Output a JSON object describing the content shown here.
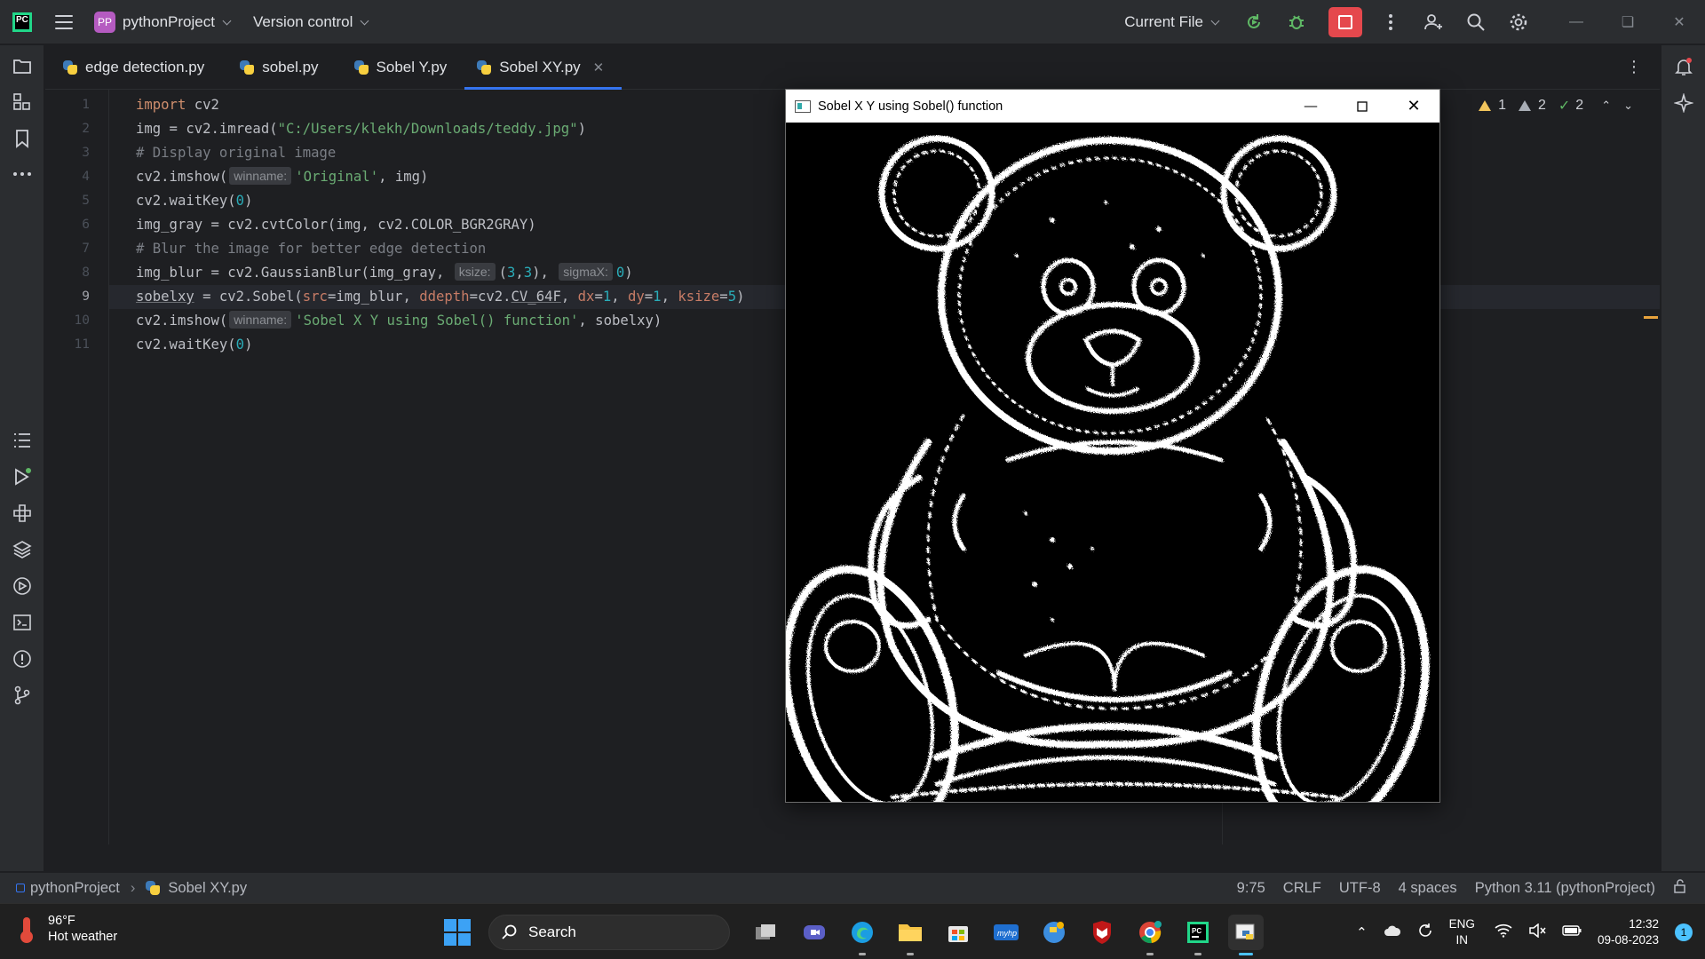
{
  "titlebar": {
    "project_badge": "PP",
    "project_name": "pythonProject",
    "version_control": "Version control",
    "run_config": "Current File"
  },
  "tabs": [
    {
      "label": "edge detection.py"
    },
    {
      "label": "sobel.py"
    },
    {
      "label": "Sobel Y.py"
    },
    {
      "label": "Sobel XY.py",
      "active": true
    }
  ],
  "editor": {
    "line_numbers": [
      "1",
      "2",
      "3",
      "4",
      "5",
      "6",
      "7",
      "8",
      "9",
      "10",
      "11"
    ],
    "current_line": 9,
    "lines": {
      "l1": {
        "kw": "import",
        "rest": " cv2"
      },
      "l2": {
        "a": "img = cv2.imread(",
        "str": "\"C:/Users/klekh/Downloads/teddy.jpg\"",
        "b": ")"
      },
      "l3": {
        "cmt": "# Display original image"
      },
      "l4": {
        "a": "cv2.imshow(",
        "hint": "winname:",
        "str": "'Original'",
        "b": ", img)"
      },
      "l5": {
        "a": "cv2.waitKey(",
        "num": "0",
        "b": ")"
      },
      "l6": {
        "a": "img_gray = cv2.cvtColor(img, cv2.COLOR_BGR2GRAY)"
      },
      "l7": {
        "cmt": "# Blur the image for better edge detection"
      },
      "l8": {
        "a": "img_blur = cv2.GaussianBlur(img_gray, ",
        "hint1": "ksize:",
        "n1": "3",
        "n2": "3",
        "hint2": "sigmaX:",
        "n3": "0"
      },
      "l9": {
        "var": "sobelxy",
        "a": " = cv2.Sobel(",
        "p1": "src",
        "v1": "=img_blur, ",
        "p2": "ddepth",
        "v2a": "=cv2.",
        "v2b": "CV_64F",
        "c1": ", ",
        "p3": "dx",
        "n1": "1",
        "c2": ", ",
        "p4": "dy",
        "n2": "1",
        "c3": ", ",
        "p5": "ksize",
        "n3": "5",
        "b": ")"
      },
      "l10": {
        "a": "cv2.imshow(",
        "hint": "winname:",
        "str": "'Sobel X Y using Sobel() function'",
        "b": ", sobelxy)"
      },
      "l11": {
        "a": "cv2.waitKey(",
        "num": "0",
        "b": ")"
      }
    },
    "inspections": {
      "warnings": "1",
      "weak_warnings": "2",
      "ok": "2"
    }
  },
  "cv_window": {
    "title": "Sobel X Y using Sobel() function",
    "image_description_icon": "sobel-edge-teddy-bear-image"
  },
  "statusbar": {
    "project": "pythonProject",
    "file": "Sobel XY.py",
    "position": "9:75",
    "line_sep": "CRLF",
    "encoding": "UTF-8",
    "indent": "4 spaces",
    "interpreter": "Python 3.11 (pythonProject)"
  },
  "taskbar": {
    "temp": "96°F",
    "weather": "Hot weather",
    "search": "Search",
    "lang_top": "ENG",
    "lang_bottom": "IN",
    "time": "12:32",
    "date": "09-08-2023",
    "notifications": "1"
  },
  "colors": {
    "accent": "#3574f0",
    "stop": "#e5484d",
    "keyword": "#cf8e6d",
    "string": "#6aab73",
    "number": "#2aacb8"
  }
}
